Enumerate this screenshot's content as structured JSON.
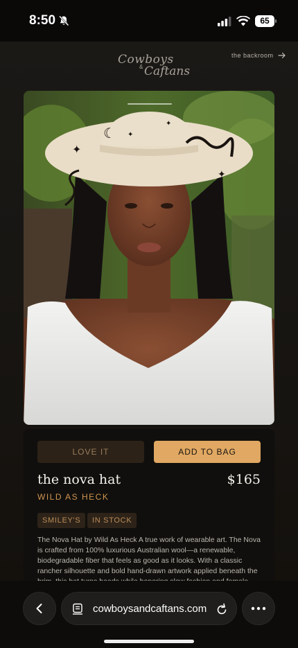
{
  "status_bar": {
    "time": "8:50",
    "battery": "65"
  },
  "header": {
    "logo_line1": "Cowboys",
    "logo_amp": "&",
    "logo_line2": "Caftans",
    "backroom_link": "the backroom"
  },
  "product": {
    "love_label": "LOVE IT",
    "add_label": "ADD TO BAG",
    "name": "the nova hat",
    "price": "$165",
    "brand": "WILD AS HECK",
    "tags": [
      "SMILEY'S",
      "IN STOCK"
    ],
    "description": "The Nova Hat by Wild As Heck A true work of wearable art. The Nova is crafted from 100% luxurious Australian wool—a renewable, biodegradable fiber that feels as good as it looks. With a classic rancher silhouette and bold hand-drawn artwork applied beneath the brim, this hat turns heads while honoring slow fashion and female"
  },
  "browser": {
    "url": "cowboysandcaftans.com"
  },
  "icons": {
    "mute": "bell-slash-icon",
    "signal": "cellular-signal-icon",
    "wifi": "wifi-icon",
    "arrow": "arrow-right-icon",
    "back": "chevron-left-icon",
    "tabs": "tab-page-icon",
    "reload": "reload-icon",
    "more": "ellipsis-icon"
  },
  "colors": {
    "accent": "#e0a862",
    "brand_text": "#d19450",
    "background": "#181613"
  }
}
